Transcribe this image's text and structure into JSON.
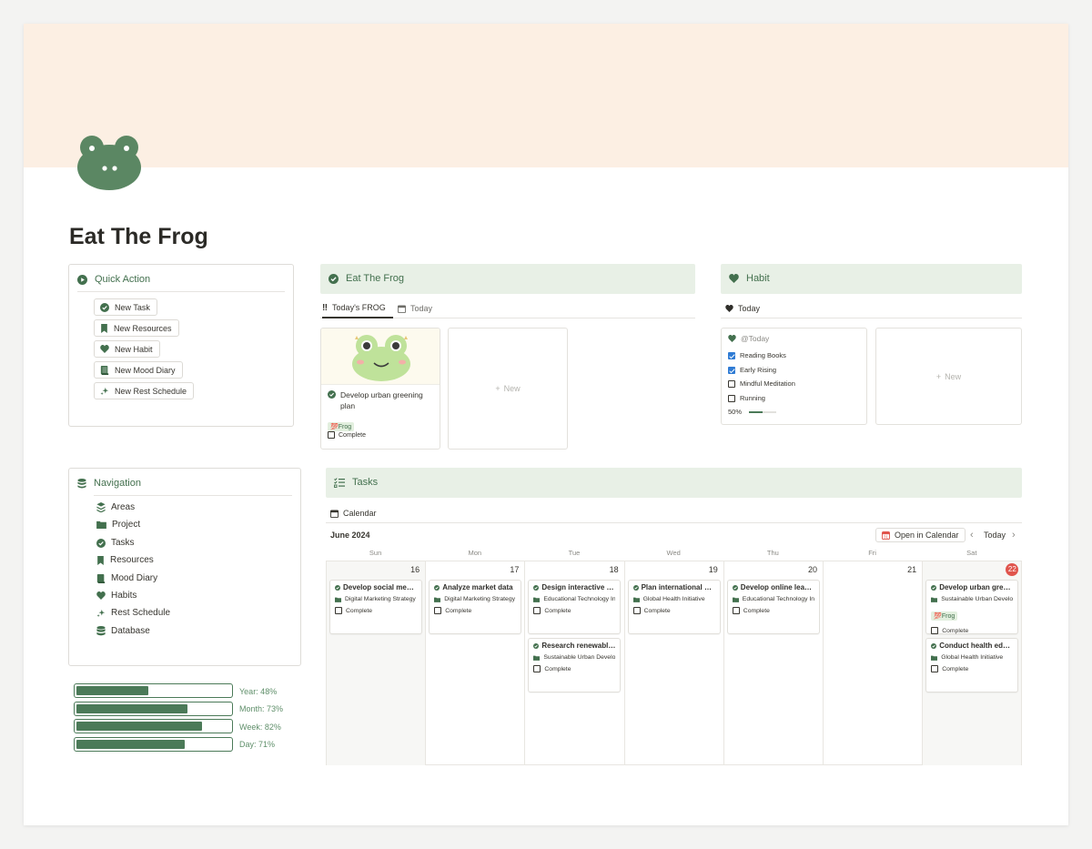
{
  "page": {
    "title": "Eat The Frog",
    "colors": {
      "accent": "#43704e",
      "cover": "#fcefe3",
      "header_bg": "#e8f0e6",
      "today_marker": "#e0554d"
    }
  },
  "quick_action": {
    "title": "Quick Action",
    "icon": "play-circle-icon",
    "buttons": [
      {
        "label": "New Task",
        "icon": "check-circle-icon"
      },
      {
        "label": "New Resources",
        "icon": "bookmark-icon"
      },
      {
        "label": "New Habit",
        "icon": "heart-icon"
      },
      {
        "label": "New Mood Diary",
        "icon": "book-icon"
      },
      {
        "label": "New Rest Schedule",
        "icon": "sparkle-icon"
      }
    ]
  },
  "frog_section": {
    "title": "Eat The Frog",
    "tabs": [
      {
        "label": "Today's FROG",
        "icon": "double-exclamation-icon",
        "active": true
      },
      {
        "label": "Today",
        "icon": "calendar-icon",
        "active": false
      }
    ],
    "card": {
      "title": "Develop urban greening plan",
      "tag": "Frog",
      "complete_label": "Complete",
      "complete": false
    },
    "new_label": "New"
  },
  "habit": {
    "title": "Habit",
    "tab": "Today",
    "card_title": "@Today",
    "items": [
      {
        "label": "Reading Books",
        "checked": true
      },
      {
        "label": "Early Rising",
        "checked": true
      },
      {
        "label": "Mindful Meditation",
        "checked": false
      },
      {
        "label": "Running",
        "checked": false
      }
    ],
    "progress_label": "50%",
    "progress": 0.5,
    "new_label": "New"
  },
  "navigation": {
    "title": "Navigation",
    "items": [
      {
        "label": "Areas",
        "icon": "stack-icon"
      },
      {
        "label": "Project",
        "icon": "folder-icon"
      },
      {
        "label": "Tasks",
        "icon": "check-circle-icon"
      },
      {
        "label": "Resources",
        "icon": "bookmark-icon"
      },
      {
        "label": "Mood Diary",
        "icon": "book-icon"
      },
      {
        "label": "Habits",
        "icon": "heart-icon"
      },
      {
        "label": "Rest Schedule",
        "icon": "sparkle-icon"
      },
      {
        "label": "Database",
        "icon": "database-icon"
      }
    ]
  },
  "progress": [
    {
      "label": "Year: 48%",
      "percent": 48
    },
    {
      "label": "Month: 73%",
      "percent": 73
    },
    {
      "label": "Week: 82%",
      "percent": 82
    },
    {
      "label": "Day: 71%",
      "percent": 71
    }
  ],
  "tasks": {
    "title": "Tasks",
    "view_tab": "Calendar",
    "month": "June 2024",
    "open_in_calendar": "Open in Calendar",
    "today_label": "Today",
    "weekdays": [
      "Sun",
      "Mon",
      "Tue",
      "Wed",
      "Thu",
      "Fri",
      "Sat"
    ],
    "days": [
      {
        "date": "16",
        "weekend": true,
        "today": false,
        "events": [
          {
            "title": "Develop social media ad campaign",
            "project": "Digital Marketing Strategy",
            "complete_label": "Complete"
          }
        ]
      },
      {
        "date": "17",
        "weekend": false,
        "today": false,
        "events": [
          {
            "title": "Analyze market data",
            "project": "Digital Marketing Strategy",
            "complete_label": "Complete"
          }
        ]
      },
      {
        "date": "18",
        "weekend": false,
        "today": false,
        "events": [
          {
            "title": "Design interactive learning",
            "project": "Educational Technology Innovation",
            "complete_label": "Complete"
          },
          {
            "title": "Research renewable energy",
            "project": "Sustainable Urban Development",
            "complete_label": "Complete"
          }
        ]
      },
      {
        "date": "19",
        "weekend": false,
        "today": false,
        "events": [
          {
            "title": "Plan international health",
            "project": "Global Health Initiative",
            "complete_label": "Complete"
          }
        ]
      },
      {
        "date": "20",
        "weekend": false,
        "today": false,
        "events": [
          {
            "title": "Develop online learning",
            "project": "Educational Technology Innovation",
            "complete_label": "Complete"
          }
        ]
      },
      {
        "date": "21",
        "weekend": false,
        "today": false,
        "events": []
      },
      {
        "date": "22",
        "weekend": true,
        "today": true,
        "events": [
          {
            "title": "Develop urban greening plan",
            "project": "Sustainable Urban Development",
            "tag": "Frog",
            "complete_label": "Complete"
          },
          {
            "title": "Conduct health education",
            "project": "Global Health Initiative",
            "complete_label": "Complete"
          }
        ]
      }
    ]
  }
}
